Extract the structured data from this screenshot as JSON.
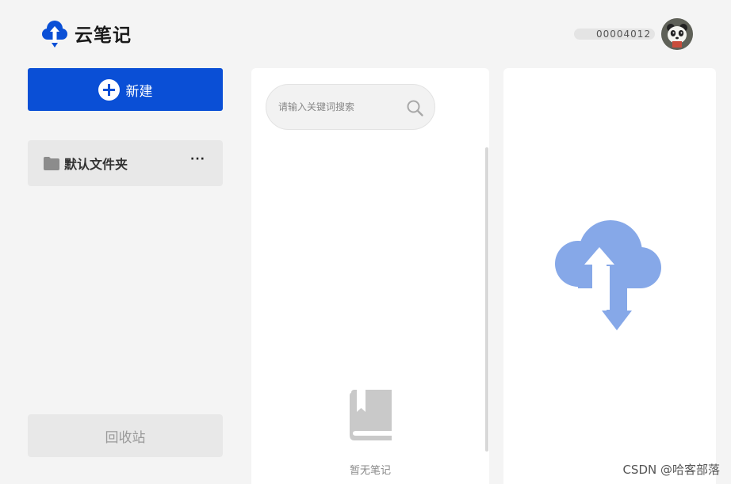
{
  "app": {
    "title": "云笔记",
    "brand_color": "#0a4fd6"
  },
  "user": {
    "name": "00004012"
  },
  "sidebar": {
    "new_button_label": "新建",
    "folders": [
      {
        "label": "默认文件夹",
        "more": "···"
      }
    ],
    "recycle_label": "回收站"
  },
  "notes": {
    "search_placeholder": "请输入关键词搜索",
    "search_value": "",
    "empty_text": "暂无笔记"
  },
  "watermark": "CSDN @哈客部落",
  "colors": {
    "cloud_big": "#86a8e8",
    "empty_icon": "#c9c9c9"
  }
}
